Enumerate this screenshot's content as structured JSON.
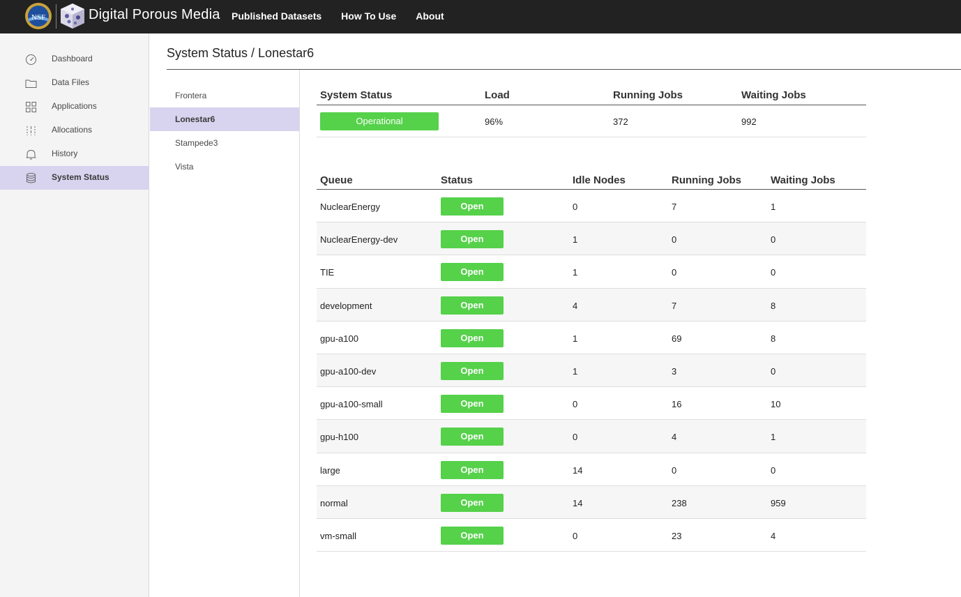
{
  "header": {
    "brand": "Digital Porous Media",
    "nsf_logo_text": "NSF",
    "nav": [
      {
        "label": "Published Datasets"
      },
      {
        "label": "How To Use"
      },
      {
        "label": "About"
      }
    ]
  },
  "sidebar": {
    "items": [
      {
        "label": "Dashboard",
        "icon": "gauge-icon",
        "active": false
      },
      {
        "label": "Data Files",
        "icon": "folder-icon",
        "active": false
      },
      {
        "label": "Applications",
        "icon": "grid-icon",
        "active": false
      },
      {
        "label": "Allocations",
        "icon": "sliders-icon",
        "active": false
      },
      {
        "label": "History",
        "icon": "bell-icon",
        "active": false
      },
      {
        "label": "System Status",
        "icon": "database-icon",
        "active": true
      }
    ]
  },
  "page": {
    "title": "System Status / Lonestar6"
  },
  "systems": {
    "items": [
      {
        "label": "Frontera",
        "active": false
      },
      {
        "label": "Lonestar6",
        "active": true
      },
      {
        "label": "Stampede3",
        "active": false
      },
      {
        "label": "Vista",
        "active": false
      }
    ]
  },
  "summary": {
    "headers": [
      "System Status",
      "Load",
      "Running Jobs",
      "Waiting Jobs"
    ],
    "status": "Operational",
    "load": "96%",
    "running_jobs": "372",
    "waiting_jobs": "992"
  },
  "queues": {
    "headers": [
      "Queue",
      "Status",
      "Idle Nodes",
      "Running Jobs",
      "Waiting Jobs"
    ],
    "rows": [
      {
        "name": "NuclearEnergy",
        "status": "Open",
        "idle": "0",
        "running": "7",
        "waiting": "1"
      },
      {
        "name": "NuclearEnergy-dev",
        "status": "Open",
        "idle": "1",
        "running": "0",
        "waiting": "0"
      },
      {
        "name": "TIE",
        "status": "Open",
        "idle": "1",
        "running": "0",
        "waiting": "0"
      },
      {
        "name": "development",
        "status": "Open",
        "idle": "4",
        "running": "7",
        "waiting": "8"
      },
      {
        "name": "gpu-a100",
        "status": "Open",
        "idle": "1",
        "running": "69",
        "waiting": "8"
      },
      {
        "name": "gpu-a100-dev",
        "status": "Open",
        "idle": "1",
        "running": "3",
        "waiting": "0"
      },
      {
        "name": "gpu-a100-small",
        "status": "Open",
        "idle": "0",
        "running": "16",
        "waiting": "10"
      },
      {
        "name": "gpu-h100",
        "status": "Open",
        "idle": "0",
        "running": "4",
        "waiting": "1"
      },
      {
        "name": "large",
        "status": "Open",
        "idle": "14",
        "running": "0",
        "waiting": "0"
      },
      {
        "name": "normal",
        "status": "Open",
        "idle": "14",
        "running": "238",
        "waiting": "959"
      },
      {
        "name": "vm-small",
        "status": "Open",
        "idle": "0",
        "running": "23",
        "waiting": "4"
      }
    ]
  },
  "colors": {
    "topbar": "#222222",
    "active_highlight": "#d8d3ef",
    "status_green": "#55d14a"
  }
}
